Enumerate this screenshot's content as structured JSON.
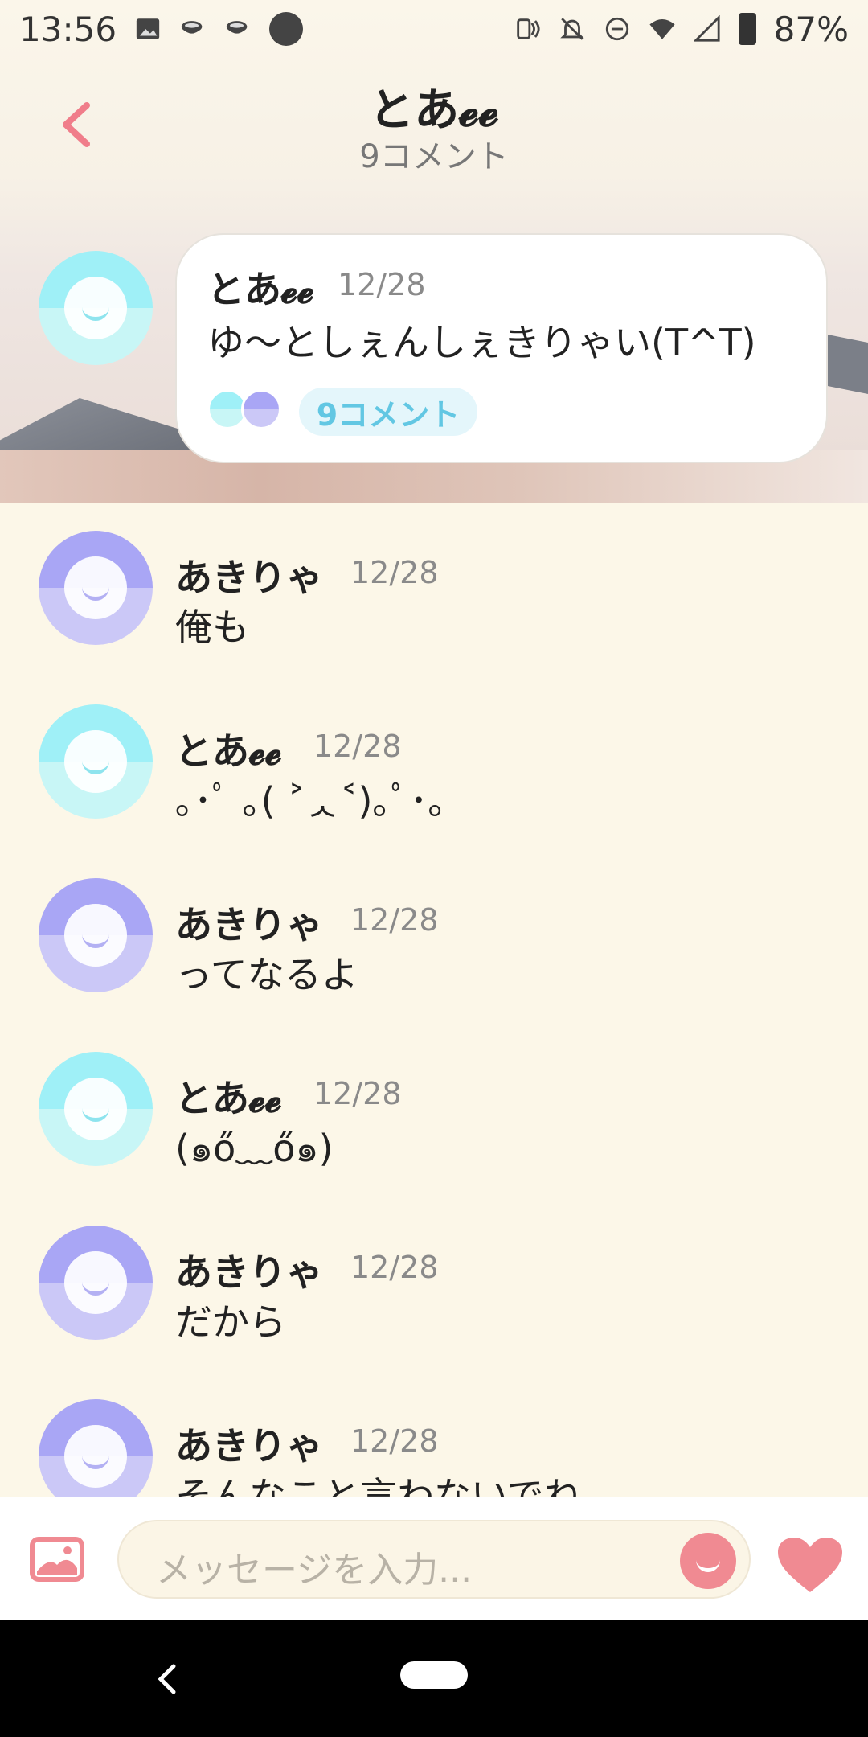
{
  "status_bar": {
    "time": "13:56",
    "battery": "87%",
    "icons": [
      "image-icon",
      "cup-icon",
      "cup-icon",
      "circle-icon",
      "nfc-icon",
      "bell-off-icon",
      "dnd-icon",
      "wifi-icon",
      "signal-icon",
      "battery-icon"
    ]
  },
  "header": {
    "title": "とあ𝓮𝓮",
    "subtitle": "9コメント"
  },
  "post": {
    "author": "とあ𝓮𝓮",
    "date": "12/28",
    "text": "ゆ〜としぇんしぇきりゃい(T^T)",
    "comment_count_label": "9コメント"
  },
  "comments": [
    {
      "author": "あきりゃ",
      "date": "12/28",
      "text": "俺も",
      "avatar": "purple"
    },
    {
      "author": "とあ𝓮𝓮",
      "date": "12/28",
      "text": "｡･ﾟ ｡( ˃ᆺ˂)｡ﾟ･｡",
      "avatar": "cyan"
    },
    {
      "author": "あきりゃ",
      "date": "12/28",
      "text": "ってなるよ",
      "avatar": "purple"
    },
    {
      "author": "とあ𝓮𝓮",
      "date": "12/28",
      "text": "(๑ő﹏ő๑)",
      "avatar": "cyan"
    },
    {
      "author": "あきりゃ",
      "date": "12/28",
      "text": "だから",
      "avatar": "purple"
    },
    {
      "author": "あきりゃ",
      "date": "12/28",
      "text": "そんなこと言わないでね",
      "avatar": "purple"
    }
  ],
  "composer": {
    "placeholder": "メッセージを入力..."
  },
  "colors": {
    "accent": "#f08a92",
    "background": "#fcf7e8",
    "avatar_cyan": "#9ff0f7",
    "avatar_purple": "#a9a6f5",
    "pill_text": "#62c7e3"
  }
}
